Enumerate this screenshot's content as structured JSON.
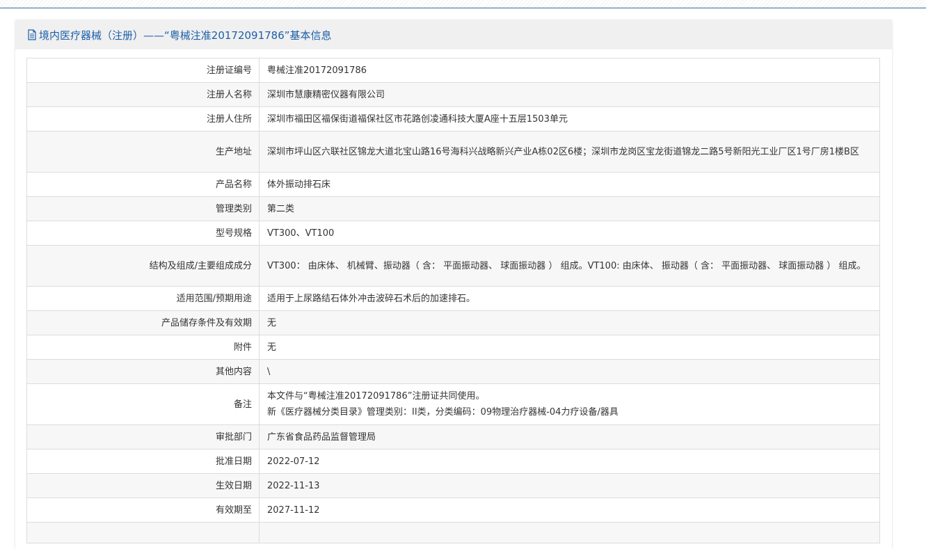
{
  "header": {
    "title": "境内医疗器械（注册）——“粤械注准20172091786”基本信息"
  },
  "icons": {
    "document": "document-icon"
  },
  "colors": {
    "accent": "#1c5fa8",
    "header_bg": "#f0f0f0",
    "border": "#dcdcdc",
    "stripe": "#f7f7f7"
  },
  "rows": [
    {
      "label": "注册证编号",
      "value": "粤械注准20172091786"
    },
    {
      "label": "注册人名称",
      "value": "深圳市慧康精密仪器有限公司"
    },
    {
      "label": "注册人住所",
      "value": "深圳市福田区福保街道福保社区市花路创凌通科技大厦A座十五层1503单元"
    },
    {
      "label": "生产地址",
      "value": "深圳市坪山区六联社区锦龙大道北宝山路16号海科兴战略新兴产业A栋02区6楼；深圳市龙岗区宝龙街道锦龙二路5号新阳光工业厂区1号厂房1楼B区"
    },
    {
      "label": "产品名称",
      "value": "体外振动排石床"
    },
    {
      "label": "管理类别",
      "value": "第二类"
    },
    {
      "label": "型号规格",
      "value": "VT300、VT100"
    },
    {
      "label": "结构及组成/主要组成成分",
      "value": "VT300： 由床体、 机械臂、振动器（ 含： 平面振动器、 球面振动器 ） 组成。VT100: 由床体、 振动器（ 含： 平面振动器、 球面振动器 ） 组成。"
    },
    {
      "label": "适用范围/预期用途",
      "value": "适用于上尿路结石体外冲击波碎石术后的加速排石。"
    },
    {
      "label": "产品储存条件及有效期",
      "value": "无"
    },
    {
      "label": "附件",
      "value": "无"
    },
    {
      "label": "其他内容",
      "value": "\\"
    },
    {
      "label": "备注",
      "value_line1": "本文件与“粤械注准20172091786”注册证共同使用。",
      "value_line2": "新《医疗器械分类目录》管理类别：II类，分类编码：09物理治疗器械-04力疗设备/器具"
    },
    {
      "label": "审批部门",
      "value": "广东省食品药品监督管理局"
    },
    {
      "label": "批准日期",
      "value": "2022-07-12"
    },
    {
      "label": "生效日期",
      "value": "2022-11-13"
    },
    {
      "label": "有效期至",
      "value": "2027-11-12"
    },
    {
      "label": "",
      "value": ""
    }
  ]
}
